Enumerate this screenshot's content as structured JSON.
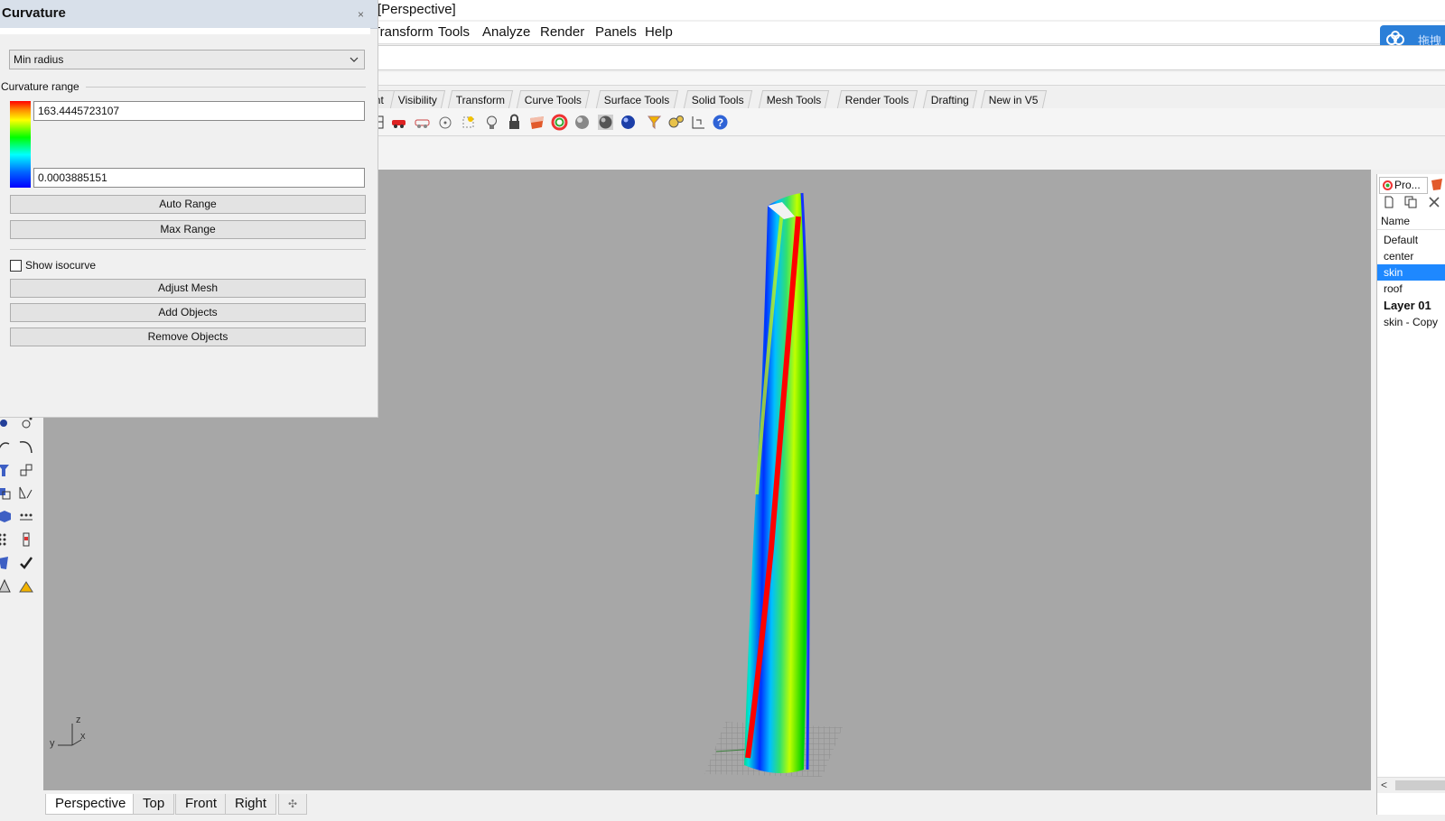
{
  "window": {
    "title": "[Perspective]"
  },
  "menu": {
    "items": [
      "Transform",
      "Tools",
      "Analyze",
      "Render",
      "Panels",
      "Help"
    ]
  },
  "cloud_widget": {
    "label": "拖拽"
  },
  "toolbar_tabs": [
    "nt",
    "Visibility",
    "Transform",
    "Curve Tools",
    "Surface Tools",
    "Solid Tools",
    "Mesh Tools",
    "Render Tools",
    "Drafting",
    "New in V5"
  ],
  "toolbar_icons": [
    "grid-icon",
    "car-icon",
    "car-outline-icon",
    "circle-dot-icon",
    "point-snap-icon",
    "lightbulb-icon",
    "lock-icon",
    "shield-icon",
    "color-wheel-icon",
    "gray-sphere-icon",
    "dark-sphere-icon",
    "outline-sphere-icon",
    "blue-sphere-icon",
    "funnel-icon",
    "gears-icon",
    "dimension-icon",
    "help-icon"
  ],
  "curvature_panel": {
    "title": "Curvature",
    "close": "×",
    "mode": "Min radius",
    "range_label": "Curvature range",
    "max_value": "163.4445723107",
    "min_value": "0.0003885151",
    "buttons": {
      "auto_range": "Auto Range",
      "max_range": "Max Range",
      "adjust_mesh": "Adjust Mesh",
      "add_objects": "Add Objects",
      "remove_objects": "Remove Objects"
    },
    "show_isocurve": {
      "label": "Show isocurve",
      "checked": false
    },
    "gradient_colors": [
      "#ff0000",
      "#ffff00",
      "#00ff00",
      "#00ffff",
      "#0000ff"
    ]
  },
  "viewport": {
    "background": "#a7a7a7",
    "axis_labels": {
      "z": "z",
      "x": "x",
      "y": "y"
    },
    "tabs": [
      "Perspective",
      "Top",
      "Front",
      "Right"
    ],
    "add_tab": "✣"
  },
  "layer_panel": {
    "tab": "Pro...",
    "column_header": "Name",
    "layers": [
      {
        "name": "Default",
        "selected": false,
        "bold": false
      },
      {
        "name": "center",
        "selected": false,
        "bold": false
      },
      {
        "name": "skin",
        "selected": true,
        "bold": false
      },
      {
        "name": "roof",
        "selected": false,
        "bold": false
      },
      {
        "name": "Layer 01",
        "selected": false,
        "bold": true
      },
      {
        "name": "skin - Copy",
        "selected": false,
        "bold": false
      }
    ],
    "scroll_left": "<"
  },
  "colors": {
    "selection": "#1e88ff",
    "cloud": "#2b7fd8"
  }
}
